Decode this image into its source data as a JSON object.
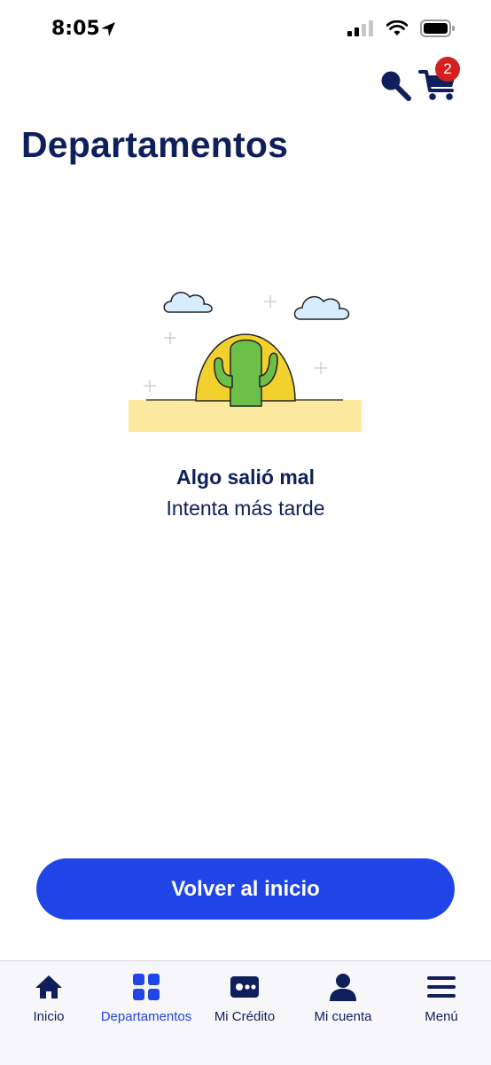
{
  "status_bar": {
    "time": "8:05"
  },
  "header": {
    "cart_badge_count": "2"
  },
  "page": {
    "title": "Departamentos"
  },
  "error": {
    "title": "Algo salió mal",
    "subtitle": "Intenta más tarde"
  },
  "actions": {
    "back_home_label": "Volver al inicio"
  },
  "tab_bar": {
    "items": [
      {
        "label": "Inicio",
        "icon": "home-icon"
      },
      {
        "label": "Departamentos",
        "icon": "grid-icon",
        "active": true
      },
      {
        "label": "Mi Crédito",
        "icon": "credit-card-icon"
      },
      {
        "label": "Mi cuenta",
        "icon": "user-icon"
      },
      {
        "label": "Menú",
        "icon": "menu-icon"
      }
    ]
  },
  "colors": {
    "primary": "#1f45e6",
    "navy": "#0f1f5c",
    "badge": "#d4201f",
    "cactus": "#6cc04a",
    "sun": "#f2d02d",
    "sand": "#fbe9a0"
  }
}
